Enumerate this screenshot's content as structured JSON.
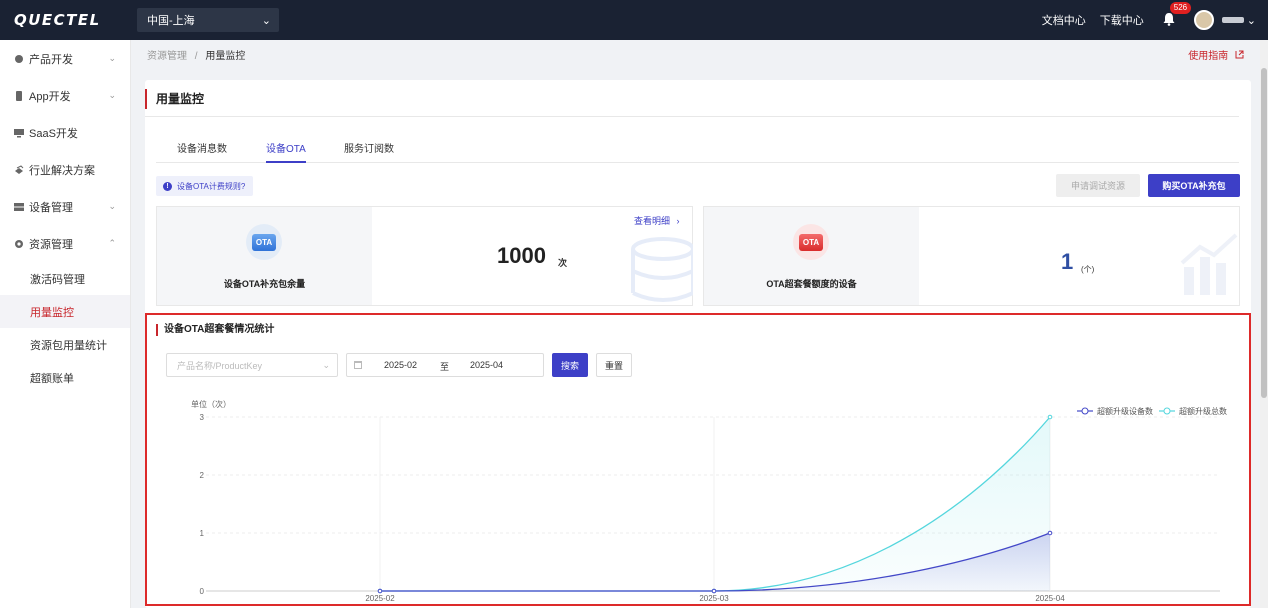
{
  "header": {
    "logo": "QUECTEL",
    "region": "中国-上海",
    "docs": "文档中心",
    "downloads": "下载中心",
    "notification_count": "526"
  },
  "sidebar": {
    "items": [
      {
        "label": "产品开发",
        "icon": "cube-icon",
        "chevron": "⌄"
      },
      {
        "label": "App开发",
        "icon": "phone-icon",
        "chevron": "⌄"
      },
      {
        "label": "SaaS开发",
        "icon": "monitor-icon",
        "chevron": ""
      },
      {
        "label": "行业解决方案",
        "icon": "layers-icon",
        "chevron": ""
      },
      {
        "label": "设备管理",
        "icon": "server-icon",
        "chevron": "⌄"
      },
      {
        "label": "资源管理",
        "icon": "gear-icon",
        "chevron": "⌃"
      }
    ],
    "sub_items": [
      {
        "label": "激活码管理",
        "active": false
      },
      {
        "label": "用量监控",
        "active": true
      },
      {
        "label": "资源包用量统计",
        "active": false
      },
      {
        "label": "超额账单",
        "active": false
      }
    ]
  },
  "breadcrumb": {
    "parent": "资源管理",
    "separator": "/",
    "current": "用量监控"
  },
  "guide_link": "使用指南",
  "page": {
    "title": "用量监控",
    "tabs": [
      "设备消息数",
      "设备OTA",
      "服务订阅数"
    ],
    "active_tab": 1,
    "rule_tag": "设备OTA计费规则?",
    "apply_button": "申请调试资源",
    "buy_button": "购买OTA补充包"
  },
  "stats": {
    "card1": {
      "label": "设备OTA补充包余量",
      "icon_text": "OTA",
      "value": "1000",
      "unit": "次",
      "detail_link": "查看明细"
    },
    "card2": {
      "label": "OTA超套餐额度的设备",
      "icon_text": "OTA",
      "value": "1",
      "unit": "(个)"
    }
  },
  "chart_section": {
    "title": "设备OTA超套餐情况统计",
    "product_placeholder": "产品名称/ProductKey",
    "date_start": "2025-02",
    "date_to": "至",
    "date_end": "2025-04",
    "search_button": "搜索",
    "reset_button": "重置"
  },
  "chart_data": {
    "type": "line",
    "unit_label": "单位（次）",
    "categories": [
      "2025-02",
      "2025-03",
      "2025-04"
    ],
    "ylim": [
      0,
      3
    ],
    "yticks": [
      "0",
      "1",
      "2",
      "3"
    ],
    "legend_position": "top-right",
    "grid": true,
    "series": [
      {
        "name": "超额升级设备数",
        "values": [
          0,
          0,
          1
        ],
        "color": "#4348c8"
      },
      {
        "name": "超额升级总数",
        "values": [
          0,
          0,
          3
        ],
        "color": "#54d6dd"
      }
    ]
  }
}
